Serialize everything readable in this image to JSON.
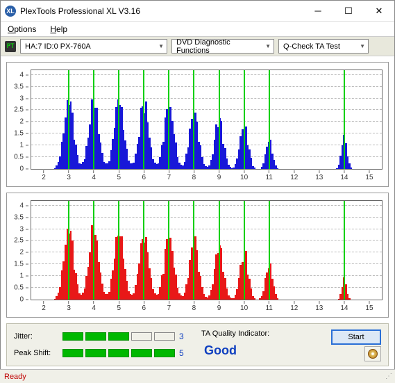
{
  "window": {
    "title": "PlexTools Professional XL V3.16",
    "logo_text": "XL"
  },
  "menu": {
    "options": "Options",
    "help": "Help"
  },
  "toolbar": {
    "pt_icon": "PT",
    "drive": "HA:7 ID:0   PX-760A",
    "category": "DVD Diagnostic Functions",
    "test": "Q-Check TA Test"
  },
  "chart_data": [
    {
      "type": "bar",
      "color": "#1818d8",
      "xlim": [
        1.5,
        15.5
      ],
      "ylim": [
        0,
        4.2
      ],
      "yticks": [
        0,
        0.5,
        1,
        1.5,
        2,
        2.5,
        3,
        3.5,
        4
      ],
      "xticks": [
        2,
        3,
        4,
        5,
        6,
        7,
        8,
        9,
        10,
        11,
        12,
        13,
        14,
        15
      ],
      "green_lines": [
        3,
        4,
        5,
        6,
        7,
        8,
        9,
        10,
        11,
        14
      ],
      "peaks": [
        {
          "center": 3,
          "height": 3.1,
          "width": 0.9
        },
        {
          "center": 4,
          "height": 3.0,
          "width": 0.9
        },
        {
          "center": 5,
          "height": 3.0,
          "width": 0.9
        },
        {
          "center": 6,
          "height": 2.9,
          "width": 0.9
        },
        {
          "center": 7,
          "height": 2.8,
          "width": 0.9
        },
        {
          "center": 8,
          "height": 2.5,
          "width": 0.85
        },
        {
          "center": 9,
          "height": 2.3,
          "width": 0.8
        },
        {
          "center": 10,
          "height": 2.0,
          "width": 0.75
        },
        {
          "center": 11,
          "height": 1.3,
          "width": 0.6
        },
        {
          "center": 14,
          "height": 1.4,
          "width": 0.5
        }
      ]
    },
    {
      "type": "bar",
      "color": "#e81818",
      "xlim": [
        1.5,
        15.5
      ],
      "ylim": [
        0,
        4.2
      ],
      "yticks": [
        0,
        0.5,
        1,
        1.5,
        2,
        2.5,
        3,
        3.5,
        4
      ],
      "xticks": [
        2,
        3,
        4,
        5,
        6,
        7,
        8,
        9,
        10,
        11,
        12,
        13,
        14,
        15
      ],
      "green_lines": [
        3,
        4,
        5,
        6,
        7,
        8,
        9,
        10,
        11,
        14
      ],
      "peaks": [
        {
          "center": 3,
          "height": 3.15,
          "width": 0.9
        },
        {
          "center": 4,
          "height": 3.1,
          "width": 0.9
        },
        {
          "center": 5,
          "height": 3.0,
          "width": 0.9
        },
        {
          "center": 6,
          "height": 2.9,
          "width": 0.9
        },
        {
          "center": 7,
          "height": 2.8,
          "width": 0.9
        },
        {
          "center": 8,
          "height": 2.55,
          "width": 0.85
        },
        {
          "center": 9,
          "height": 2.4,
          "width": 0.8
        },
        {
          "center": 10,
          "height": 2.1,
          "width": 0.75
        },
        {
          "center": 11,
          "height": 1.5,
          "width": 0.65
        },
        {
          "center": 14,
          "height": 0.9,
          "width": 0.4
        }
      ]
    }
  ],
  "stats": {
    "jitter_label": "Jitter:",
    "jitter_segments": 3,
    "jitter_total": 5,
    "jitter_value": "3",
    "peak_label": "Peak Shift:",
    "peak_segments": 5,
    "peak_total": 5,
    "peak_value": "5",
    "ta_label": "TA Quality Indicator:",
    "ta_value": "Good",
    "start_label": "Start"
  },
  "status": {
    "ready": "Ready"
  }
}
